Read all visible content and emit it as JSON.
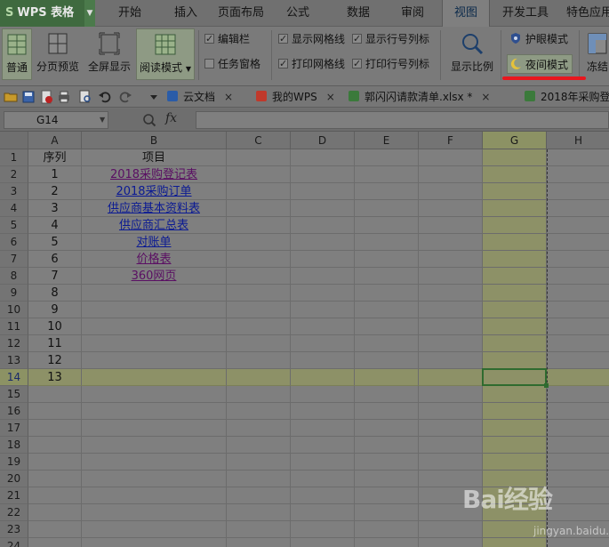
{
  "app": {
    "logo_mark": "S",
    "name": "WPS 表格"
  },
  "menu": {
    "tabs": [
      "开始",
      "插入",
      "页面布局",
      "公式",
      "数据",
      "审阅",
      "视图",
      "开发工具",
      "特色应用"
    ],
    "active": "视图"
  },
  "ribbon": {
    "normal": "普通",
    "page_break_preview": "分页预览",
    "full_screen": "全屏显示",
    "reading_mode": "阅读模式",
    "edit_bar": "编辑栏",
    "task_pane": "任务窗格",
    "show_gridlines": "显示网格线",
    "print_gridlines": "打印网格线",
    "show_headers": "显示行号列标",
    "print_headers": "打印行号列标",
    "zoom": "显示比例",
    "eye_care": "护眼模式",
    "night_mode": "夜间模式",
    "freeze": "冻结"
  },
  "checks": {
    "edit_bar": true,
    "task_pane": false,
    "show_gridlines": true,
    "print_gridlines": true,
    "show_headers": true,
    "print_headers": true
  },
  "doc_tabs": [
    "云文档",
    "我的WPS",
    "郭闪闪请款清单.xlsx *",
    "2018年采购登"
  ],
  "formula_bar": {
    "name_box": "G14",
    "fx": "fx",
    "value": ""
  },
  "columns": [
    "A",
    "B",
    "C",
    "D",
    "E",
    "F",
    "G",
    "H"
  ],
  "active_column": "G",
  "active_row": 14,
  "rows": [
    {
      "n": 1,
      "a": "序列",
      "b": "项目",
      "link": false
    },
    {
      "n": 2,
      "a": "1",
      "b": "2018采购登记表",
      "link": true,
      "visited": true
    },
    {
      "n": 3,
      "a": "2",
      "b": "2018采购订单",
      "link": true,
      "visited": false
    },
    {
      "n": 4,
      "a": "3",
      "b": "供应商基本资料表",
      "link": true,
      "visited": false
    },
    {
      "n": 5,
      "a": "4",
      "b": "供应商汇总表",
      "link": true,
      "visited": false
    },
    {
      "n": 6,
      "a": "5",
      "b": "对账单",
      "link": true,
      "visited": false
    },
    {
      "n": 7,
      "a": "6",
      "b": "价格表",
      "link": true,
      "visited": true
    },
    {
      "n": 8,
      "a": "7",
      "b": "360网页",
      "link": true,
      "visited": true
    },
    {
      "n": 9,
      "a": "8",
      "b": "",
      "link": false
    },
    {
      "n": 10,
      "a": "9",
      "b": "",
      "link": false
    },
    {
      "n": 11,
      "a": "10",
      "b": "",
      "link": false
    },
    {
      "n": 12,
      "a": "11",
      "b": "",
      "link": false
    },
    {
      "n": 13,
      "a": "12",
      "b": "",
      "link": false
    },
    {
      "n": 14,
      "a": "13",
      "b": "",
      "link": false
    },
    {
      "n": 15,
      "a": "",
      "b": "",
      "link": false
    },
    {
      "n": 16,
      "a": "",
      "b": "",
      "link": false
    },
    {
      "n": 17,
      "a": "",
      "b": "",
      "link": false
    },
    {
      "n": 18,
      "a": "",
      "b": "",
      "link": false
    },
    {
      "n": 19,
      "a": "",
      "b": "",
      "link": false
    },
    {
      "n": 20,
      "a": "",
      "b": "",
      "link": false
    },
    {
      "n": 21,
      "a": "",
      "b": "",
      "link": false
    },
    {
      "n": 22,
      "a": "",
      "b": "",
      "link": false
    },
    {
      "n": 23,
      "a": "",
      "b": "",
      "link": false
    },
    {
      "n": 24,
      "a": "",
      "b": "",
      "link": false
    }
  ],
  "watermark": {
    "logo": "Bai经验",
    "url": "jingyan.baidu.com"
  },
  "colors": {
    "highlight": "#8d9167",
    "selection_border": "#2f6b2f",
    "annotation_red": "#e8171e",
    "link": "#0b1a93",
    "link_visited": "#5a0f63"
  }
}
